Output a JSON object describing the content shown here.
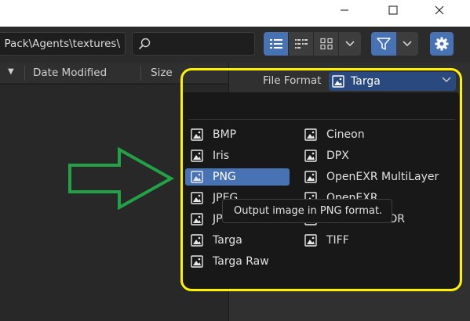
{
  "window": {
    "controls": [
      "minimize-icon",
      "maximize-icon",
      "close-icon"
    ]
  },
  "toolbar": {
    "path": "el Pack\\Agents\\textures\\",
    "search_placeholder": "",
    "view_modes": [
      "vertical-list-icon",
      "horizontal-list-icon",
      "thumbnails-icon"
    ],
    "accent": "#4772b3"
  },
  "columns": {
    "date": "Date Modified",
    "size": "Size"
  },
  "file_format": {
    "label": "File Format",
    "selected": "Targa"
  },
  "format_menu": {
    "left": [
      "BMP",
      "Iris",
      "PNG",
      "JPEG",
      "JPEG 2000",
      "Targa",
      "Targa Raw"
    ],
    "right": [
      "Cineon",
      "DPX",
      "OpenEXR MultiLayer",
      "OpenEXR",
      "Radiance HDR",
      "TIFF"
    ],
    "highlighted": "PNG"
  },
  "tooltip": {
    "text": "Output image in PNG format."
  },
  "annotations": {
    "highlight_color": "#fff200",
    "arrow_color": "#22a246"
  }
}
